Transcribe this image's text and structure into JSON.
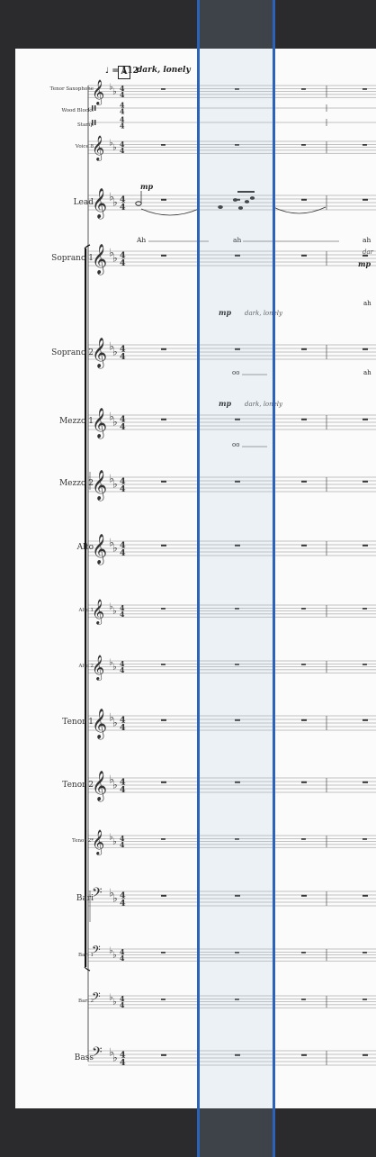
{
  "score": {
    "tempo": "♩ = 112",
    "rehearsal_mark": "A",
    "expression": "dark, lonely",
    "time_signature": [
      "4",
      "4"
    ],
    "dynamics": "mp",
    "lyrics": {
      "lead_1": "Ah",
      "lead_2": "ah",
      "lead_3": "ah",
      "soprano1_right": "ah",
      "soprano2_right": "ah",
      "oo": "oo"
    },
    "small_expression_right": "dar",
    "instruments": [
      "Tenor Saxophone",
      "Wood Blocks",
      "Stamp",
      "Voice 8",
      "Lead",
      "Soprano 1",
      "Soprano 2",
      "Mezzo 1",
      "Mezzo 2",
      "Alto",
      "Alto 1",
      "Alto 2",
      "Tenor 1",
      "Tenor 2",
      "Tenor 2*",
      "Bari",
      "Bari 1",
      "Bari 2",
      "Bass"
    ]
  },
  "selection": {
    "color": "#2a63b8"
  }
}
